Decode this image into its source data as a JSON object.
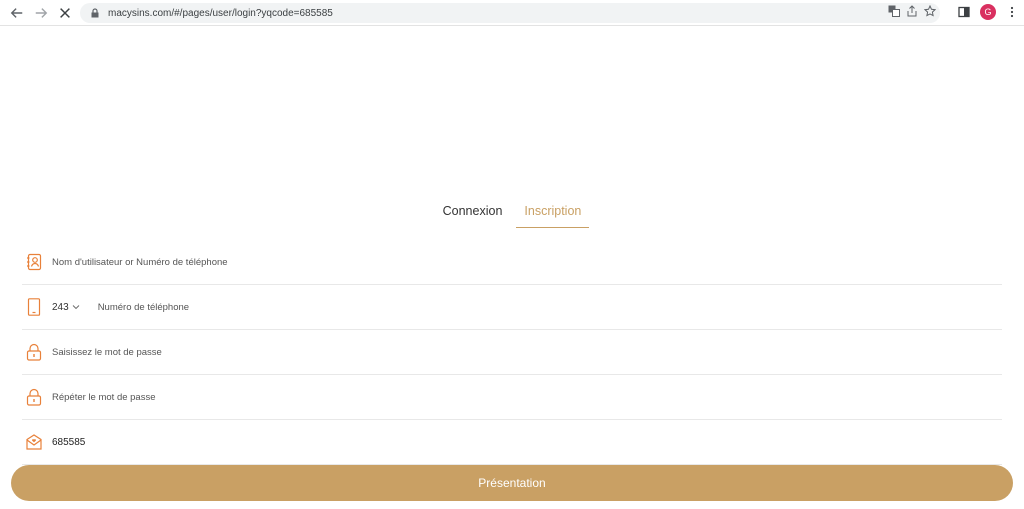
{
  "browser": {
    "url": "macysins.com/#/pages/user/login?yqcode=685585",
    "avatar_letter": "G"
  },
  "tabs": [
    {
      "label": "Connexion",
      "active": false
    },
    {
      "label": "Inscription",
      "active": true
    }
  ],
  "form": {
    "username_placeholder": "Nom d'utilisateur or Numéro de téléphone",
    "country_code": "243",
    "phone_placeholder": "Numéro de téléphone",
    "password_placeholder": "Saisissez le mot de passe",
    "confirm_password_placeholder": "Répéter le mot de passe",
    "invite_code_value": "685585"
  },
  "submit_label": "Présentation",
  "colors": {
    "accent": "#c9a064",
    "icon": "#e8813a",
    "avatar": "#d93060"
  }
}
